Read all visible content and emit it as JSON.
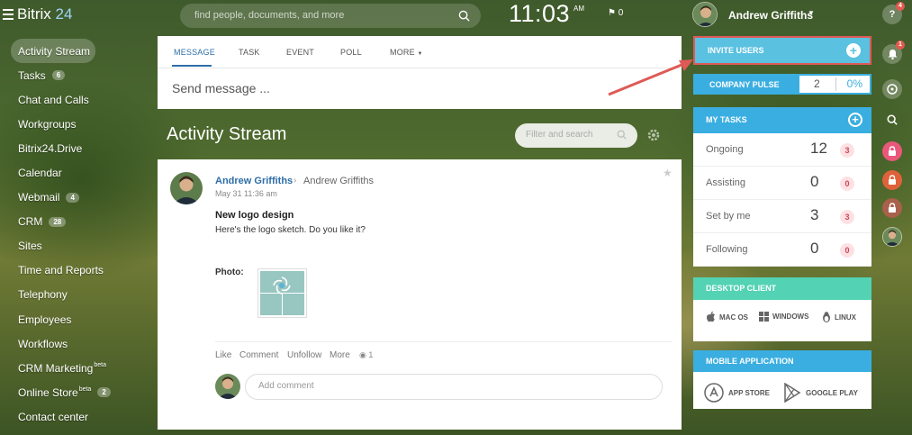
{
  "app": {
    "logo_text": "Bitrix",
    "logo_num": "24"
  },
  "header": {
    "search_placeholder": "find people, documents, and more",
    "clock": "11:03",
    "ampm": "AM",
    "flag_count": "0",
    "user_name": "Andrew Griffiths",
    "help_badge": "4"
  },
  "sidebar": {
    "items": [
      {
        "label": "Activity Stream",
        "badge": "",
        "sup": ""
      },
      {
        "label": "Tasks",
        "badge": "6",
        "sup": ""
      },
      {
        "label": "Chat and Calls",
        "badge": "",
        "sup": ""
      },
      {
        "label": "Workgroups",
        "badge": "",
        "sup": ""
      },
      {
        "label": "Bitrix24.Drive",
        "badge": "",
        "sup": ""
      },
      {
        "label": "Calendar",
        "badge": "",
        "sup": ""
      },
      {
        "label": "Webmail",
        "badge": "4",
        "sup": ""
      },
      {
        "label": "CRM",
        "badge": "28",
        "sup": ""
      },
      {
        "label": "Sites",
        "badge": "",
        "sup": ""
      },
      {
        "label": "Time and Reports",
        "badge": "",
        "sup": ""
      },
      {
        "label": "Telephony",
        "badge": "",
        "sup": ""
      },
      {
        "label": "Employees",
        "badge": "",
        "sup": ""
      },
      {
        "label": "Workflows",
        "badge": "",
        "sup": ""
      },
      {
        "label": "CRM Marketing",
        "badge": "",
        "sup": "beta"
      },
      {
        "label": "Online Store",
        "badge": "2",
        "sup": "beta"
      },
      {
        "label": "Contact center",
        "badge": "",
        "sup": ""
      }
    ]
  },
  "composer": {
    "tabs": [
      "MESSAGE",
      "TASK",
      "EVENT",
      "POLL",
      "MORE"
    ],
    "placeholder": "Send message ..."
  },
  "stream": {
    "title": "Activity Stream",
    "filter_placeholder": "Filter and search"
  },
  "post": {
    "author": "Andrew Griffiths",
    "recipient": "Andrew Griffiths",
    "date": "May 31 11:36 am",
    "title": "New logo design",
    "body": "Here's the logo sketch. Do you like it?",
    "photo_label": "Photo:",
    "actions": [
      "Like",
      "Comment",
      "Unfollow",
      "More"
    ],
    "views": "1",
    "comment_placeholder": "Add comment"
  },
  "right": {
    "invite_label": "INVITE USERS",
    "pulse_label": "COMPANY PULSE",
    "pulse_value": "2",
    "pulse_percent": "0%",
    "tasks_title": "MY TASKS",
    "tasks": [
      {
        "label": "Ongoing",
        "count": "12",
        "badge": "3"
      },
      {
        "label": "Assisting",
        "count": "0",
        "badge": "0"
      },
      {
        "label": "Set by me",
        "count": "3",
        "badge": "3"
      },
      {
        "label": "Following",
        "count": "0",
        "badge": "0"
      }
    ],
    "desktop_title": "DESKTOP CLIENT",
    "desktop_links": [
      "MAC OS",
      "WINDOWS",
      "LINUX"
    ],
    "mobile_title": "MOBILE APPLICATION",
    "mobile_links": [
      "APP STORE",
      "GOOGLE PLAY"
    ]
  },
  "strip": {
    "notif_badge": "1"
  },
  "colors": {
    "accent": "#3aaee0",
    "link": "#2d6ea8",
    "desktop": "#53d2b4",
    "annotation": "#e05a55"
  }
}
